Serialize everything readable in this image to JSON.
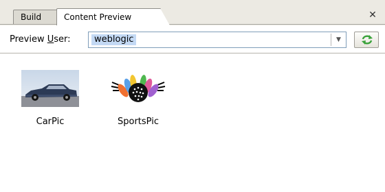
{
  "tabs": [
    {
      "label": "Build",
      "active": false
    },
    {
      "label": "Content Preview",
      "active": true
    }
  ],
  "toolbar": {
    "preview_user_label_pre": "Preview ",
    "preview_user_label_mnemonic": "U",
    "preview_user_label_post": "ser:",
    "preview_user_value": "weblogic"
  },
  "icons": {
    "tab_close": "close-icon",
    "combo_dropdown": "chevron-down-icon",
    "refresh": "refresh-icon"
  },
  "content": {
    "items": [
      {
        "label": "CarPic",
        "icon": "car-image"
      },
      {
        "label": "SportsPic",
        "icon": "sports-image"
      }
    ]
  },
  "colors": {
    "tab_strip_bg": "#eceae3",
    "selection_bg": "#c3d9f4",
    "refresh_green": "#3aa23a"
  }
}
